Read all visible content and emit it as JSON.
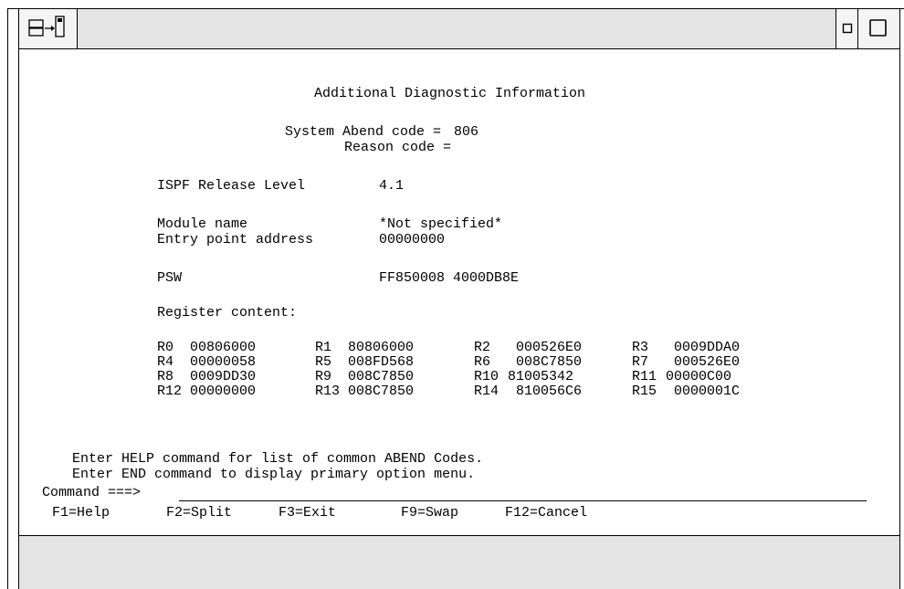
{
  "title": "Additional Diagnostic Information",
  "abend": {
    "system_label": "System Abend code =",
    "system_value": "806",
    "reason_label": "Reason code ="
  },
  "release": {
    "label": "ISPF Release Level",
    "value": "4.1"
  },
  "module": {
    "label": "Module name",
    "value": "*Not specified*"
  },
  "entry": {
    "label": "Entry point address",
    "value": "00000000"
  },
  "psw": {
    "label": "PSW",
    "value": "FF850008 4000DB8E"
  },
  "registers": {
    "heading": "Register content:",
    "rows": [
      [
        {
          "name": "R0",
          "value": "00806000"
        },
        {
          "name": "R1",
          "value": "80806000"
        },
        {
          "name": "R2",
          "value": "000526E0"
        },
        {
          "name": "R3",
          "value": "0009DDA0"
        }
      ],
      [
        {
          "name": "R4",
          "value": "00000058"
        },
        {
          "name": "R5",
          "value": "008FD568"
        },
        {
          "name": "R6",
          "value": "008C7850"
        },
        {
          "name": "R7",
          "value": "000526E0"
        }
      ],
      [
        {
          "name": "R8",
          "value": "0009DD30"
        },
        {
          "name": "R9",
          "value": "008C7850"
        },
        {
          "name": "R10",
          "value": "81005342"
        },
        {
          "name": "R11",
          "value": "00000C00"
        }
      ],
      [
        {
          "name": "R12",
          "value": "00000000"
        },
        {
          "name": "R13",
          "value": "008C7850"
        },
        {
          "name": "R14",
          "value": "810056C6"
        },
        {
          "name": "R15",
          "value": "0000001C"
        }
      ]
    ]
  },
  "messages": {
    "help": "Enter HELP command for list of common ABEND Codes.",
    "end": "Enter END command to display primary option menu."
  },
  "command": {
    "label": "Command ===>",
    "value": ""
  },
  "function_keys": [
    {
      "label": "F1=Help"
    },
    {
      "label": "F2=Split"
    },
    {
      "label": "F3=Exit"
    },
    {
      "label": "F9=Swap"
    },
    {
      "label": "F12=Cancel"
    }
  ],
  "icons": {
    "top_left": "session-transfer-icon",
    "top_right_small": "minimize-square-icon",
    "top_right_large": "maximize-square-icon"
  }
}
